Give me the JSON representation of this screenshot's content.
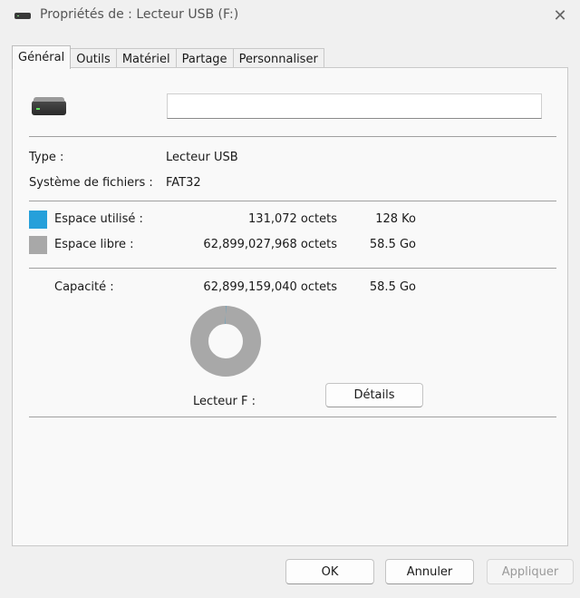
{
  "window": {
    "title": "Propriétés de : Lecteur USB (F:)",
    "close_glyph": "✕"
  },
  "tabs": [
    {
      "label": "Général",
      "active": true
    },
    {
      "label": "Outils",
      "active": false
    },
    {
      "label": "Matériel",
      "active": false
    },
    {
      "label": "Partage",
      "active": false
    },
    {
      "label": "Personnaliser",
      "active": false
    }
  ],
  "general": {
    "drive_icon": "usb-drive-icon",
    "name_value": "",
    "type_label": "Type :",
    "type_value": "Lecteur USB",
    "fs_label": "Système de fichiers :",
    "fs_value": "FAT32",
    "used": {
      "label": "Espace utilisé :",
      "bytes": "131,072 octets",
      "size": "128 Ko",
      "color": "#26a0da"
    },
    "free": {
      "label": "Espace libre :",
      "bytes": "62,899,027,968 octets",
      "size": "58.5 Go",
      "color": "#a8a8a8"
    },
    "capacity": {
      "label": "Capacité :",
      "bytes": "62,899,159,040 octets",
      "size": "58.5 Go"
    },
    "usage_fraction": 2.1e-06,
    "drive_label": "Lecteur F :",
    "details_button": "Détails"
  },
  "footer": {
    "ok": "OK",
    "cancel": "Annuler",
    "apply": "Appliquer"
  }
}
